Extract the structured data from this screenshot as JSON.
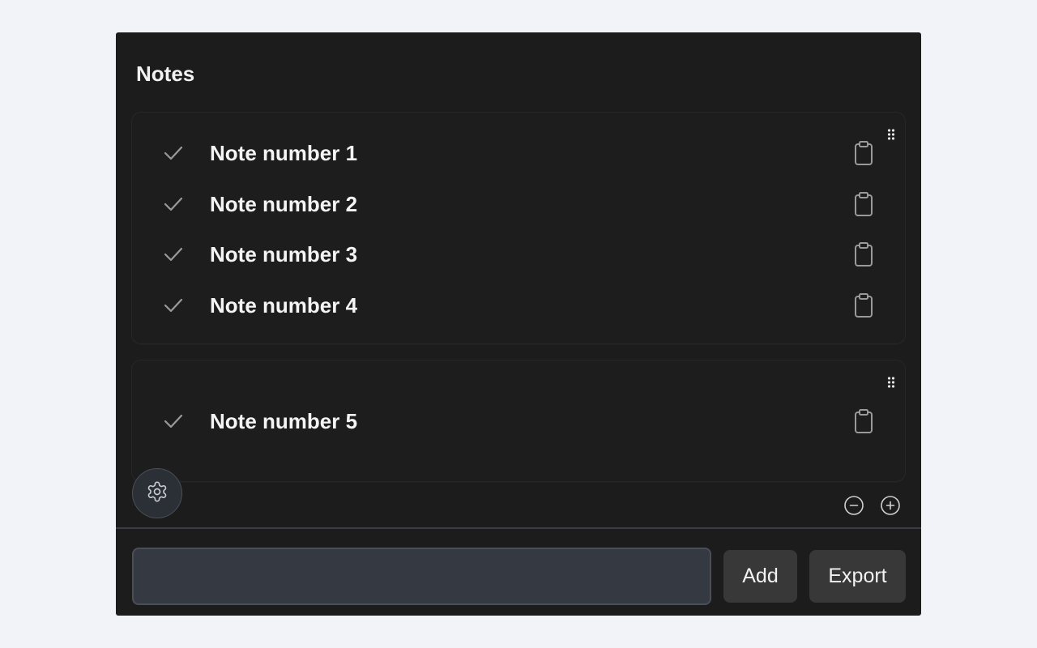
{
  "notes_panel": {
    "title": "Notes",
    "groups": [
      {
        "notes": [
          {
            "text": "Note number 1"
          },
          {
            "text": "Note number 2"
          },
          {
            "text": "Note number 3"
          },
          {
            "text": "Note number 4"
          }
        ]
      },
      {
        "notes": [
          {
            "text": "Note number 5"
          }
        ]
      }
    ],
    "icons": {
      "check": "check-icon",
      "copy": "clipboard-icon",
      "drag": "drag-handle-icon",
      "settings": "gear-icon",
      "zoom_out": "minus-circle-icon",
      "zoom_in": "plus-circle-icon"
    }
  },
  "footer": {
    "input_value": "",
    "input_placeholder": "",
    "add_label": "Add",
    "export_label": "Export"
  },
  "colors": {
    "page_background": "#f1f3f8",
    "panel_background": "#1c1c1c",
    "input_background": "#353a42",
    "button_background": "#383838",
    "text": "#f4f4f4",
    "icon": "#9a9a9a"
  }
}
